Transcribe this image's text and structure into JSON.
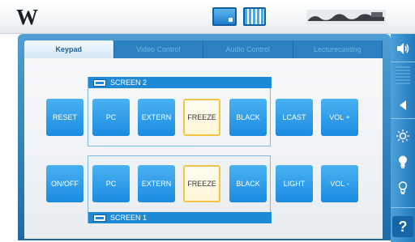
{
  "header": {
    "logo": "W"
  },
  "tabs": [
    {
      "label": "Keypad",
      "active": true
    },
    {
      "label": "Video Control",
      "active": false
    },
    {
      "label": "Audio Control",
      "active": false
    },
    {
      "label": "Lecturecasting",
      "active": false
    }
  ],
  "screens": {
    "top_label": "SCREEN 2",
    "bottom_label": "SCREEN 1"
  },
  "keys": {
    "reset": "RESET",
    "pc_top": "PC",
    "extern_top": "EXTERN",
    "freeze_top": "FREEZE",
    "black_top": "BLACK",
    "lcast": "LCAST",
    "vol_up": "VOL +",
    "onoff": "ON/OFF",
    "pc_bottom": "PC",
    "extern_bottom": "EXTERN",
    "freeze_bottom": "FREEZE",
    "black_bottom": "BLACK",
    "light": "LIGHT",
    "vol_down": "VOL -"
  },
  "sidebar": {
    "help": "?"
  },
  "colors": {
    "key_blue": "#2a9be6",
    "freeze_border": "#f3c542",
    "frame_blue": "#2a7fc0",
    "screen_label_blue": "#1e8ad6"
  }
}
